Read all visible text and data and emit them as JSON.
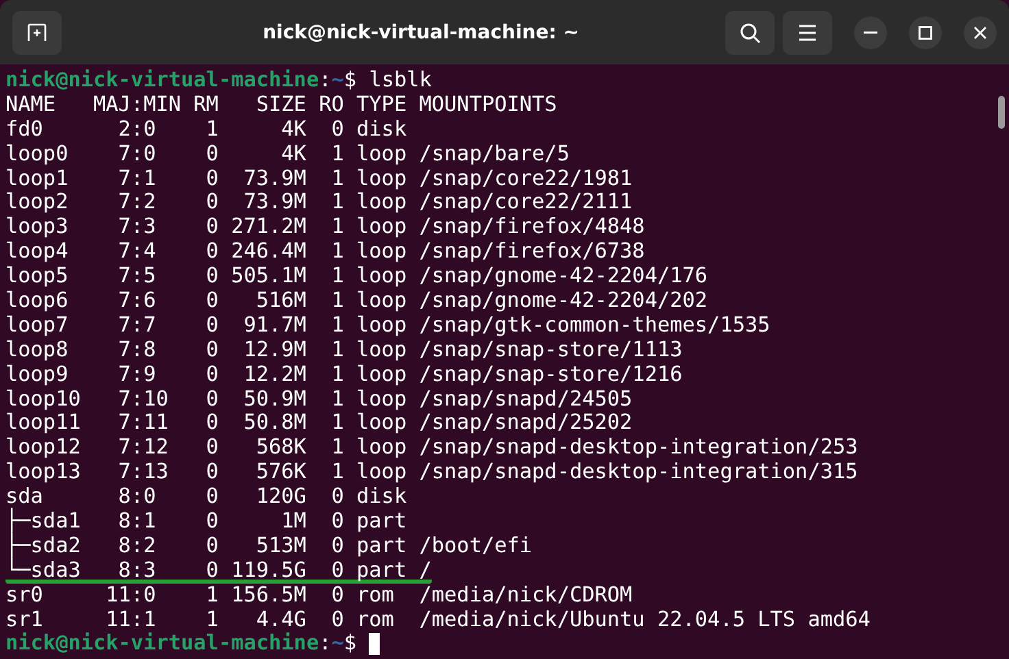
{
  "window": {
    "title": "nick@nick-virtual-machine: ~"
  },
  "terminal": {
    "lines": [
      {
        "kind": "prompt",
        "user_host": "nick@nick-virtual-machine",
        "separator": ":",
        "path": "~",
        "symbol": "$",
        "command": "lsblk"
      },
      {
        "kind": "output",
        "text": "NAME   MAJ:MIN RM   SIZE RO TYPE MOUNTPOINTS",
        "underlined": false
      },
      {
        "kind": "output",
        "text": "fd0      2:0    1     4K  0 disk",
        "underlined": false
      },
      {
        "kind": "output",
        "text": "loop0    7:0    0     4K  1 loop /snap/bare/5",
        "underlined": false
      },
      {
        "kind": "output",
        "text": "loop1    7:1    0  73.9M  1 loop /snap/core22/1981",
        "underlined": false
      },
      {
        "kind": "output",
        "text": "loop2    7:2    0  73.9M  1 loop /snap/core22/2111",
        "underlined": false
      },
      {
        "kind": "output",
        "text": "loop3    7:3    0 271.2M  1 loop /snap/firefox/4848",
        "underlined": false
      },
      {
        "kind": "output",
        "text": "loop4    7:4    0 246.4M  1 loop /snap/firefox/6738",
        "underlined": false
      },
      {
        "kind": "output",
        "text": "loop5    7:5    0 505.1M  1 loop /snap/gnome-42-2204/176",
        "underlined": false
      },
      {
        "kind": "output",
        "text": "loop6    7:6    0   516M  1 loop /snap/gnome-42-2204/202",
        "underlined": false
      },
      {
        "kind": "output",
        "text": "loop7    7:7    0  91.7M  1 loop /snap/gtk-common-themes/1535",
        "underlined": false
      },
      {
        "kind": "output",
        "text": "loop8    7:8    0  12.9M  1 loop /snap/snap-store/1113",
        "underlined": false
      },
      {
        "kind": "output",
        "text": "loop9    7:9    0  12.2M  1 loop /snap/snap-store/1216",
        "underlined": false
      },
      {
        "kind": "output",
        "text": "loop10   7:10   0  50.9M  1 loop /snap/snapd/24505",
        "underlined": false
      },
      {
        "kind": "output",
        "text": "loop11   7:11   0  50.8M  1 loop /snap/snapd/25202",
        "underlined": false
      },
      {
        "kind": "output",
        "text": "loop12   7:12   0   568K  1 loop /snap/snapd-desktop-integration/253",
        "underlined": false
      },
      {
        "kind": "output",
        "text": "loop13   7:13   0   576K  1 loop /snap/snapd-desktop-integration/315",
        "underlined": false
      },
      {
        "kind": "output",
        "text": "sda      8:0    0   120G  0 disk",
        "underlined": false
      },
      {
        "kind": "output",
        "text": "├─sda1   8:1    0     1M  0 part",
        "underlined": false
      },
      {
        "kind": "output",
        "text": "├─sda2   8:2    0   513M  0 part /boot/efi",
        "underlined": false
      },
      {
        "kind": "output",
        "text": "└─sda3   8:3    0 119.5G  0 part /",
        "underlined": true
      },
      {
        "kind": "output",
        "text": "sr0     11:0    1 156.5M  0 rom  /media/nick/CDROM",
        "underlined": false
      },
      {
        "kind": "output",
        "text": "sr1     11:1    1   4.4G  0 rom  /media/nick/Ubuntu 22.04.5 LTS amd64",
        "underlined": false
      },
      {
        "kind": "prompt",
        "user_host": "nick@nick-virtual-machine",
        "separator": ":",
        "path": "~",
        "symbol": "$"
      }
    ]
  }
}
